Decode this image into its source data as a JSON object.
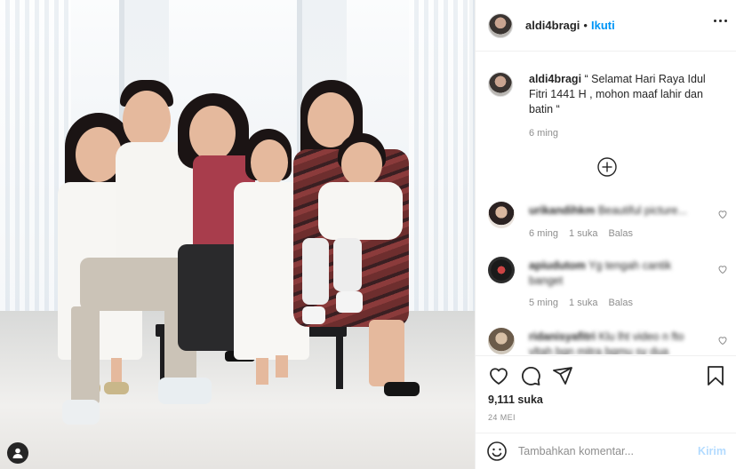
{
  "post": {
    "username": "aldi4bragi",
    "separator": "•",
    "follow_label": "Ikuti",
    "caption_username": "aldi4bragi",
    "caption_text": "“ Selamat Hari Raya Idul Fitri 1441 H , mohon maaf lahir dan batin “",
    "caption_time": "6 ming",
    "likes": "9,111 suka",
    "date": "24 MEI"
  },
  "comments": [
    {
      "username": "urikandihkm",
      "text": "Beautiful picture...",
      "time": "6 ming",
      "likes": "1 suka",
      "reply": "Balas"
    },
    {
      "username": "apiudutom",
      "text": "Yg tengah cantik banget",
      "time": "5 ming",
      "likes": "1 suka",
      "reply": "Balas"
    },
    {
      "username": "ridanisyafitri",
      "text": "Klu lht video n fto vltah bgn mitra bgmu sy dua",
      "time": "",
      "likes": "",
      "reply": ""
    }
  ],
  "composer": {
    "placeholder": "Tambahkan komentar...",
    "post_label": "Kirim"
  },
  "icons": {
    "more": "more-options-icon",
    "load_more": "plus-circle-icon",
    "like": "heart-icon",
    "comment": "comment-icon",
    "share": "share-icon",
    "save": "bookmark-icon",
    "emoji": "emoji-icon",
    "user_tag": "user-tag-icon"
  },
  "colors": {
    "accent": "#0095f6",
    "muted": "#8e8e8e",
    "text": "#262626",
    "border": "#efefef",
    "post_disabled": "#b3dbff"
  }
}
